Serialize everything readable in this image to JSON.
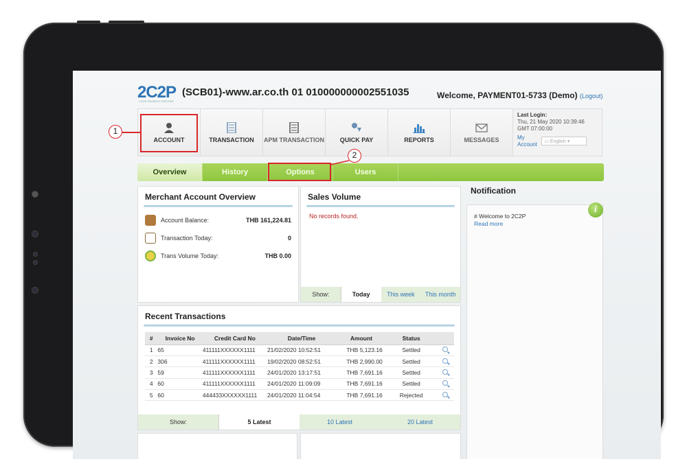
{
  "header": {
    "logo": "2C2P",
    "logo_tagline": "YOUR PAYMENT PARTNER",
    "merchant_title": "(SCB01)-www.ar.co.th 01 010000000002551035",
    "welcome": "Welcome, PAYMENT01-5733 (Demo)",
    "logout": "(Logout)"
  },
  "menu": {
    "items": [
      {
        "label": "ACCOUNT",
        "icon": "account-icon"
      },
      {
        "label": "TRANSACTION",
        "icon": "transaction-icon"
      },
      {
        "label": "APM TRANSACTION",
        "icon": "apm-transaction-icon"
      },
      {
        "label": "QUICK PAY",
        "icon": "quick-pay-icon"
      },
      {
        "label": "REPORTS",
        "icon": "reports-icon"
      },
      {
        "label": "MESSAGES",
        "icon": "messages-icon"
      }
    ],
    "last_login_title": "Last Login:",
    "last_login_date": "Thu, 21 May 2020 10:39:46",
    "last_login_tz": "GMT 07:00:00",
    "my_account": "My Account",
    "language": "English"
  },
  "annotations": {
    "one": "1",
    "two": "2"
  },
  "subtabs": [
    "Overview",
    "History",
    "Options",
    "Users"
  ],
  "overview": {
    "title": "Merchant Account Overview",
    "rows": [
      {
        "label": "Account Balance:",
        "value": "THB 161,224.81"
      },
      {
        "label": "Transaction Today:",
        "value": "0"
      },
      {
        "label": "Trans Volume Today:",
        "value": "THB 0.00"
      }
    ]
  },
  "sales": {
    "title": "Sales Volume",
    "empty": "No records found.",
    "show": "Show:",
    "today": "Today",
    "week": "This week",
    "month": "This month"
  },
  "recent": {
    "title": "Recent Transactions",
    "headers": [
      "#",
      "Invoice No",
      "Credit Card No",
      "Date/Time",
      "Amount",
      "Status"
    ],
    "rows": [
      {
        "n": "1",
        "inv": "65",
        "card": "411111XXXXXX1111",
        "dt": "21/02/2020 10:52:51",
        "amt": "THB 5,123.16",
        "status": "Settled"
      },
      {
        "n": "2",
        "inv": "306",
        "card": "411111XXXXXX1111",
        "dt": "19/02/2020 08:52:51",
        "amt": "THB 2,990.00",
        "status": "Settled"
      },
      {
        "n": "3",
        "inv": "59",
        "card": "411111XXXXXX1111",
        "dt": "24/01/2020 13:17:51",
        "amt": "THB 7,691.16",
        "status": "Settled"
      },
      {
        "n": "4",
        "inv": "60",
        "card": "411111XXXXXX1111",
        "dt": "24/01/2020 11:09:09",
        "amt": "THB 7,691.16",
        "status": "Settled"
      },
      {
        "n": "5",
        "inv": "60",
        "card": "444433XXXXXX1111",
        "dt": "24/01/2020 11:04:54",
        "amt": "THB 7,691.16",
        "status": "Rejected"
      }
    ],
    "show": "Show:",
    "five": "5 Latest",
    "ten": "10 Latest",
    "twenty": "20 Latest"
  },
  "notification": {
    "title": "Notification",
    "message": "# Welcome to 2C2P",
    "read_more": "Read more"
  },
  "colors": {
    "accent_green": "#8dc63f",
    "brand_blue": "#2e74b5",
    "annotation_red": "#d9262a"
  }
}
